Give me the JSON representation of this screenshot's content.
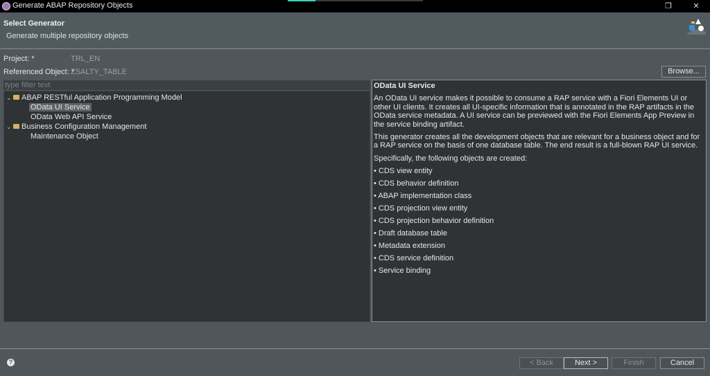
{
  "window": {
    "title": "Generate ABAP Repository Objects"
  },
  "header": {
    "title": "Select Generator",
    "subtitle": "Generate multiple repository objects"
  },
  "fields": {
    "project_label": "Project: *",
    "project_value": "TRL_EN",
    "referenced_label": "Referenced Object: *",
    "referenced_value": "ZSALTY_TABLE",
    "browse_label": "Browse..."
  },
  "filter": {
    "placeholder": "type filter text"
  },
  "tree": [
    {
      "label": "ABAP RESTful Application Programming Model",
      "level": 0,
      "expanded": true
    },
    {
      "label": "OData UI Service",
      "level": 1,
      "selected": true
    },
    {
      "label": "OData Web API Service",
      "level": 1
    },
    {
      "label": "Business Configuration Management",
      "level": 0,
      "expanded": true
    },
    {
      "label": "Maintenance Object",
      "level": 1
    }
  ],
  "description": {
    "title": "OData UI Service",
    "para1": "An OData UI service makes it possible to consume a RAP service with a Fiori Elements UI or other UI clients. It creates all UI-specific information that is annotated in the RAP artifacts in the OData service metadata. A UI service can be previewed with the Fiori Elements App Preview in the service binding artifact.",
    "para2": "This generator creates all the development objects that are relevant for a business object and for a RAP service on the basis of one database table. The end result is a full-blown RAP UI service.",
    "para3": "Specifically, the following objects are created:",
    "bullets": [
      "CDS view entity",
      "CDS behavior definition",
      "ABAP implementation class",
      "CDS projection view entity",
      "CDS projection behavior definition",
      "Draft database table",
      "Metadata extension",
      "CDS service definition",
      "Service binding"
    ]
  },
  "buttons": {
    "back": "< Back",
    "next": "Next >",
    "finish": "Finish",
    "cancel": "Cancel"
  }
}
